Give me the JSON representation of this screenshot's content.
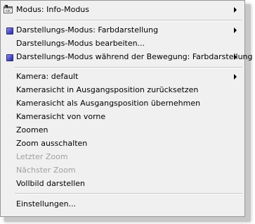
{
  "menu": {
    "items": [
      {
        "label": "Modus:  Info-Modus",
        "submenu": true,
        "icon": "info-mode-icon"
      },
      {
        "label": "Darstellungs-Modus: Farbdarstellung",
        "submenu": true,
        "icon": "cube-icon"
      },
      {
        "label": "Darstellungs-Modus bearbeiten...",
        "submenu": false
      },
      {
        "label": "Darstellungs-Modus während der Bewegung: Farbdarstellung",
        "submenu": true,
        "icon": "cube-icon"
      },
      {
        "label": "Kamera: default",
        "submenu": true
      },
      {
        "label": "Kamerasicht in Ausgangsposition zurücksetzen",
        "submenu": false
      },
      {
        "label": "Kamerasicht als Ausgangsposition übernehmen",
        "submenu": false
      },
      {
        "label": "Kamerasicht von vorne",
        "submenu": false
      },
      {
        "label": "Zoomen",
        "submenu": false
      },
      {
        "label": "Zoom ausschalten",
        "submenu": false
      },
      {
        "label": "Letzter Zoom",
        "submenu": false,
        "disabled": true
      },
      {
        "label": "Nächster Zoom",
        "submenu": false,
        "disabled": true
      },
      {
        "label": "Vollbild darstellen",
        "submenu": false
      },
      {
        "label": "Einstellungen...",
        "submenu": false
      }
    ]
  }
}
